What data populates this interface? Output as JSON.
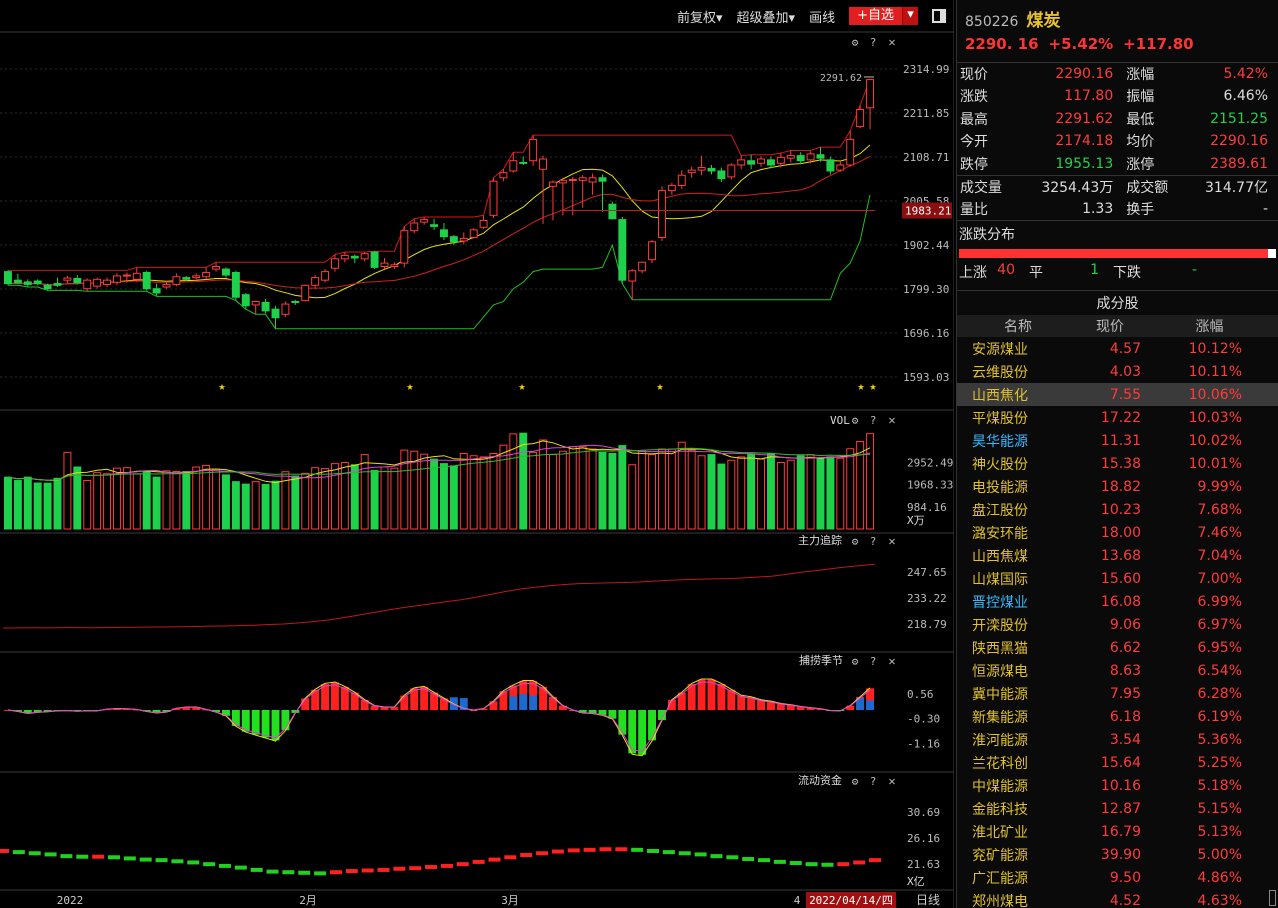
{
  "toolbar": {
    "fuquan": "前复权▾",
    "overlay": "超级叠加▾",
    "draw": "画线",
    "fav_add": "+自选",
    "fav_drop": "▾"
  },
  "colors": {
    "up": "#ff3b3b",
    "down": "#1fd04a",
    "bg": "#000000",
    "grid": "#333333",
    "ma_yellow": "#e8e010",
    "ma_red": "#d02020",
    "ma_magenta": "#e040e0",
    "band_green": "#20c020"
  },
  "chart_data": [
    {
      "type": "candlestick",
      "title": "",
      "y_ticks": [
        "2314.99",
        "2211.85",
        "2108.71",
        "2005.58",
        "1902.44",
        "1799.30",
        "1696.16",
        "1593.03"
      ],
      "ylim": [
        1593.03,
        2314.99
      ],
      "high_marker": "2291.62",
      "current_tag": "1983.21",
      "star_marks": [
        true
      ],
      "x_labels": [
        "2022",
        "2月",
        "3月",
        "4"
      ],
      "date_tag": "2022/04/14/四",
      "period": "日线",
      "ohlc": [
        [
          1840,
          1843,
          1812,
          1808
        ],
        [
          1820,
          1835,
          1814,
          1812
        ],
        [
          1816,
          1822,
          1810,
          1804
        ],
        [
          1818,
          1822,
          1812,
          1808
        ],
        [
          1808,
          1812,
          1800,
          1796
        ],
        [
          1812,
          1826,
          1808,
          1804
        ],
        [
          1820,
          1830,
          1825,
          1812
        ],
        [
          1824,
          1832,
          1814,
          1810
        ],
        [
          1800,
          1824,
          1820,
          1794
        ],
        [
          1806,
          1826,
          1822,
          1800
        ],
        [
          1810,
          1826,
          1820,
          1804
        ],
        [
          1815,
          1836,
          1830,
          1808
        ],
        [
          1830,
          1838,
          1832,
          1814
        ],
        [
          1822,
          1850,
          1836,
          1816
        ],
        [
          1838,
          1842,
          1800,
          1796
        ],
        [
          1800,
          1812,
          1790,
          1782
        ],
        [
          1804,
          1818,
          1810,
          1800
        ],
        [
          1810,
          1836,
          1828,
          1806
        ],
        [
          1826,
          1830,
          1822,
          1818
        ],
        [
          1826,
          1836,
          1830,
          1822
        ],
        [
          1828,
          1850,
          1838,
          1822
        ],
        [
          1846,
          1862,
          1852,
          1840
        ],
        [
          1846,
          1850,
          1832,
          1826
        ],
        [
          1838,
          1842,
          1780,
          1772
        ],
        [
          1786,
          1790,
          1760,
          1752
        ],
        [
          1762,
          1772,
          1770,
          1740
        ],
        [
          1768,
          1776,
          1748,
          1742
        ],
        [
          1752,
          1760,
          1732,
          1706
        ],
        [
          1740,
          1770,
          1764,
          1734
        ],
        [
          1770,
          1774,
          1768,
          1762
        ],
        [
          1772,
          1810,
          1808,
          1770
        ],
        [
          1808,
          1832,
          1826,
          1800
        ],
        [
          1820,
          1846,
          1840,
          1815
        ],
        [
          1848,
          1880,
          1870,
          1840
        ],
        [
          1870,
          1886,
          1878,
          1862
        ],
        [
          1876,
          1880,
          1872,
          1860
        ],
        [
          1870,
          1886,
          1882,
          1864
        ],
        [
          1886,
          1888,
          1850,
          1846
        ],
        [
          1852,
          1872,
          1860,
          1846
        ],
        [
          1852,
          1862,
          1856,
          1846
        ],
        [
          1860,
          1946,
          1936,
          1850
        ],
        [
          1936,
          1964,
          1954,
          1930
        ],
        [
          1956,
          1968,
          1962,
          1950
        ],
        [
          1950,
          1964,
          1946,
          1938
        ],
        [
          1938,
          1954,
          1922,
          1914
        ],
        [
          1922,
          1926,
          1910,
          1902
        ],
        [
          1912,
          1932,
          1918,
          1904
        ],
        [
          1920,
          1942,
          1938,
          1918
        ],
        [
          1944,
          1972,
          1960,
          1940
        ],
        [
          1972,
          2060,
          2052,
          1966
        ],
        [
          2060,
          2080,
          2072,
          2052
        ],
        [
          2076,
          2120,
          2100,
          2072
        ],
        [
          2096,
          2110,
          2094,
          2090
        ],
        [
          2100,
          2160,
          2150,
          2088
        ],
        [
          2080,
          2112,
          2104,
          1952
        ],
        [
          2040,
          2054,
          2050,
          1960
        ],
        [
          2048,
          2060,
          2054,
          1972
        ],
        [
          2054,
          2062,
          2056,
          1972
        ],
        [
          2054,
          2066,
          2060,
          1990
        ],
        [
          2050,
          2070,
          2060,
          2020
        ],
        [
          2060,
          2068,
          2052,
          1980
        ],
        [
          1998,
          2004,
          1964,
          1974
        ],
        [
          1962,
          1968,
          1820,
          1812
        ],
        [
          1818,
          1846,
          1842,
          1774
        ],
        [
          1842,
          1864,
          1862,
          1836
        ],
        [
          1868,
          1914,
          1910,
          1860
        ],
        [
          1920,
          2040,
          2030,
          1912
        ],
        [
          2030,
          2048,
          2042,
          2020
        ],
        [
          2042,
          2078,
          2066,
          2034
        ],
        [
          2072,
          2086,
          2078,
          2060
        ],
        [
          2078,
          2112,
          2084,
          2066
        ],
        [
          2082,
          2090,
          2076,
          2068
        ],
        [
          2076,
          2084,
          2058,
          2050
        ],
        [
          2062,
          2094,
          2090,
          2056
        ],
        [
          2090,
          2112,
          2102,
          2080
        ],
        [
          2100,
          2114,
          2092,
          2080
        ],
        [
          2094,
          2110,
          2104,
          2086
        ],
        [
          2102,
          2110,
          2090,
          2082
        ],
        [
          2094,
          2118,
          2108,
          2084
        ],
        [
          2106,
          2124,
          2112,
          2096
        ],
        [
          2112,
          2120,
          2100,
          2092
        ],
        [
          2102,
          2122,
          2116,
          2094
        ],
        [
          2114,
          2132,
          2106,
          2098
        ],
        [
          2102,
          2110,
          2076,
          2068
        ],
        [
          2078,
          2100,
          2090,
          2074
        ],
        [
          2090,
          2170,
          2150,
          2086
        ],
        [
          2180,
          2230,
          2220,
          2176
        ],
        [
          2224,
          2291.62,
          2290.16,
          2174.18
        ]
      ]
    },
    {
      "type": "bar",
      "title": "VOL",
      "y_ticks": [
        "2952.49",
        "1968.33",
        "984.16"
      ],
      "unit": "X万",
      "values": [
        2300,
        2150,
        2300,
        2040,
        2030,
        2250,
        3400,
        2750,
        2150,
        2500,
        2450,
        2700,
        2720,
        2450,
        2550,
        2300,
        2580,
        2550,
        2550,
        2750,
        2820,
        2650,
        2400,
        2100,
        1990,
        2100,
        1980,
        2120,
        2540,
        2350,
        2470,
        2720,
        2680,
        2900,
        2950,
        2850,
        3300,
        2600,
        2750,
        2700,
        3500,
        3450,
        3320,
        3100,
        2900,
        2800,
        3350,
        3250,
        3200,
        3350,
        3720,
        4220,
        4250,
        3400,
        3950,
        3300,
        3450,
        3650,
        3650,
        3550,
        3400,
        3350,
        3700,
        2850,
        3450,
        3300,
        3550,
        3550,
        3850,
        3500,
        3250,
        3300,
        2880,
        3050,
        3200,
        3320,
        3100,
        3350,
        2950,
        3050,
        3250,
        3300,
        3130,
        3200,
        3140,
        3560,
        3880,
        4230
      ]
    },
    {
      "type": "line",
      "title": "主力追踪",
      "y_ticks": [
        "247.65",
        "233.22",
        "218.79"
      ],
      "values": [
        216.5,
        216.6,
        216.7,
        216.6,
        216.8,
        216.8,
        216.7,
        216.8,
        216.9,
        217,
        217.1,
        217.1,
        217.3,
        217.4,
        217.6,
        217.7,
        217.9,
        218.1,
        218.5,
        218.8,
        219.4,
        220.1,
        221,
        222.3,
        223.6,
        225,
        226.5,
        227.8,
        228.9,
        230,
        231.2,
        232.2,
        233.6,
        235.2,
        236.8,
        238.2,
        239.2,
        240,
        240.7,
        241.2,
        241.4,
        241.6,
        241.8,
        242.1,
        242.6,
        243,
        243.4,
        243.6,
        243.8,
        244,
        244.3,
        244.8,
        245.3,
        246.3,
        247.5,
        248.4,
        249.4,
        250.4,
        251.2,
        252
      ]
    },
    {
      "type": "bar",
      "title": "捕捞季节",
      "y_ticks": [
        "0.56",
        "-0.30",
        "-1.16"
      ],
      "values": [
        0,
        -0.05,
        -0.12,
        -0.08,
        -0.06,
        -0.03,
        -0.02,
        -0.04,
        -0.03,
        -0.03,
        0.03,
        0.05,
        0.04,
        0.02,
        -0.05,
        -0.1,
        -0.07,
        0.06,
        0.1,
        0.1,
        0.02,
        -0.07,
        -0.2,
        -0.55,
        -0.75,
        -0.85,
        -0.95,
        -1.05,
        -0.7,
        -0.1,
        0.4,
        0.7,
        0.9,
        0.95,
        0.8,
        0.6,
        0.35,
        0.15,
        0.1,
        0.1,
        0.5,
        0.75,
        0.8,
        0.6,
        0.4,
        0.2,
        0.05,
        0,
        0.05,
        0.3,
        0.65,
        0.85,
        1,
        1,
        0.8,
        0.45,
        0.15,
        0,
        -0.1,
        -0.12,
        -0.18,
        -0.3,
        -0.85,
        -1.5,
        -1.55,
        -1.05,
        -0.35,
        0.35,
        0.6,
        0.9,
        1.05,
        1.05,
        0.9,
        0.7,
        0.5,
        0.45,
        0.35,
        0.3,
        0.22,
        0.18,
        0.12,
        0.08,
        0.04,
        -0.02,
        -0.03,
        0.15,
        0.45,
        0.75
      ]
    },
    {
      "type": "scatter",
      "title": "流动资金",
      "y_ticks": [
        "30.69",
        "26.16",
        "21.63"
      ],
      "unit": "X亿",
      "values": [
        23.9,
        23.7,
        23.5,
        23.3,
        23.0,
        22.9,
        22.9,
        22.8,
        22.6,
        22.4,
        22.3,
        22.1,
        21.9,
        21.6,
        21.3,
        21.0,
        20.6,
        20.3,
        20.2,
        20.1,
        20.0,
        20.2,
        20.4,
        20.5,
        20.6,
        20.8,
        20.9,
        21.1,
        21.3,
        21.6,
        22.0,
        22.4,
        22.8,
        23.2,
        23.5,
        23.8,
        24.0,
        24.1,
        24.2,
        24.2,
        24.1,
        23.9,
        23.7,
        23.5,
        23.3,
        23.0,
        22.8,
        22.5,
        22.3,
        22.0,
        21.8,
        21.6,
        21.5,
        21.6,
        21.9,
        22.3
      ]
    }
  ],
  "quote": {
    "code": "850226",
    "name": "煤炭",
    "price": "2290. 16",
    "pct": "+5.42%",
    "chg": "+117.80",
    "rows": [
      [
        "现价",
        "2290.16",
        "red",
        "涨幅",
        "5.42%",
        "red"
      ],
      [
        "涨跌",
        "117.80",
        "red",
        "振幅",
        "6.46%",
        "wht"
      ],
      [
        "最高",
        "2291.62",
        "red",
        "最低",
        "2151.25",
        "grn"
      ],
      [
        "今开",
        "2174.18",
        "red",
        "均价",
        "2290.16",
        "red"
      ],
      [
        "跌停",
        "1955.13",
        "grn",
        "涨停",
        "2389.61",
        "red"
      ],
      [
        "成交量",
        "3254.43万",
        "wht",
        "成交额",
        "314.77亿",
        "wht"
      ],
      [
        "量比",
        "1.33",
        "wht",
        "换手",
        "-",
        "wht"
      ]
    ]
  },
  "dist": {
    "title": "涨跌分布",
    "up_label": "上涨",
    "up": "40",
    "flat_label": "平",
    "flat": "1",
    "down_label": "下跌",
    "down": "-"
  },
  "comp": {
    "title": "成分股",
    "h1": "名称",
    "h2": "现价",
    "h3": "涨幅",
    "rows": [
      [
        "安源煤业",
        "4.57",
        "10.12%",
        "yel"
      ],
      [
        "云维股份",
        "4.03",
        "10.11%",
        "yel"
      ],
      [
        "山西焦化",
        "7.55",
        "10.06%",
        "yel"
      ],
      [
        "平煤股份",
        "17.22",
        "10.03%",
        "yel"
      ],
      [
        "昊华能源",
        "11.31",
        "10.02%",
        "blu"
      ],
      [
        "神火股份",
        "15.38",
        "10.01%",
        "yel"
      ],
      [
        "电投能源",
        "18.82",
        "9.99%",
        "yel"
      ],
      [
        "盘江股份",
        "10.23",
        "7.68%",
        "yel"
      ],
      [
        "潞安环能",
        "18.00",
        "7.46%",
        "yel"
      ],
      [
        "山西焦煤",
        "13.68",
        "7.04%",
        "yel"
      ],
      [
        "山煤国际",
        "15.60",
        "7.00%",
        "yel"
      ],
      [
        "晋控煤业",
        "16.08",
        "6.99%",
        "blu"
      ],
      [
        "开滦股份",
        "9.06",
        "6.97%",
        "yel"
      ],
      [
        "陕西黑猫",
        "6.62",
        "6.95%",
        "yel"
      ],
      [
        "恒源煤电",
        "8.63",
        "6.54%",
        "yel"
      ],
      [
        "冀中能源",
        "7.95",
        "6.28%",
        "yel"
      ],
      [
        "新集能源",
        "6.18",
        "6.19%",
        "yel"
      ],
      [
        "淮河能源",
        "3.54",
        "5.36%",
        "yel"
      ],
      [
        "兰花科创",
        "15.64",
        "5.25%",
        "yel"
      ],
      [
        "中煤能源",
        "10.16",
        "5.18%",
        "yel"
      ],
      [
        "金能科技",
        "12.87",
        "5.15%",
        "yel"
      ],
      [
        "淮北矿业",
        "16.79",
        "5.13%",
        "yel"
      ],
      [
        "兖矿能源",
        "39.90",
        "5.00%",
        "yel"
      ],
      [
        "广汇能源",
        "9.50",
        "4.86%",
        "yel"
      ],
      [
        "郑州煤电",
        "4.52",
        "4.63%",
        "yel"
      ]
    ]
  }
}
